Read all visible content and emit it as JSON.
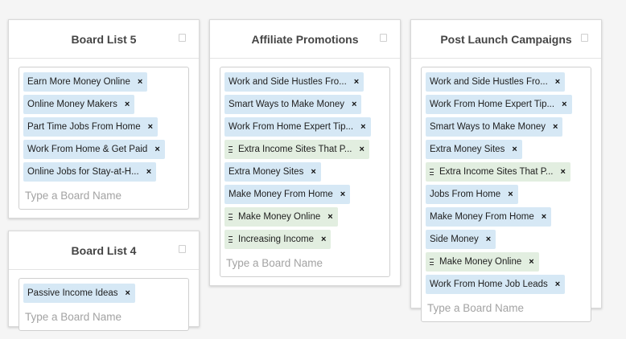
{
  "columns": [
    {
      "title": "Board List 5",
      "tags": [
        {
          "label": "Earn More Money Online",
          "draggable": false
        },
        {
          "label": "Online Money Makers",
          "draggable": false
        },
        {
          "label": "Part Time Jobs From Home",
          "draggable": false
        },
        {
          "label": "Work From Home & Get Paid",
          "draggable": false
        },
        {
          "label": "Online Jobs for Stay-at-H...",
          "draggable": false
        }
      ],
      "placeholder": "Type a Board Name"
    },
    {
      "title": "Board List 4",
      "tags": [
        {
          "label": "Passive Income Ideas",
          "draggable": false
        }
      ],
      "placeholder": "Type a Board Name"
    },
    {
      "title": "Affiliate Promotions",
      "tags": [
        {
          "label": "Work and Side Hustles Fro...",
          "draggable": false
        },
        {
          "label": "Smart Ways to Make Money",
          "draggable": false
        },
        {
          "label": "Work From Home Expert Tip...",
          "draggable": false
        },
        {
          "label": "Extra Income Sites That P...",
          "draggable": true
        },
        {
          "label": "Extra Money Sites",
          "draggable": false
        },
        {
          "label": "Make Money From Home",
          "draggable": false
        },
        {
          "label": "Make Money Online",
          "draggable": true
        },
        {
          "label": "Increasing Income",
          "draggable": true
        }
      ],
      "placeholder": "Type a Board Name"
    },
    {
      "title": "Post Launch Campaigns",
      "tags": [
        {
          "label": "Work and Side Hustles Fro...",
          "draggable": false
        },
        {
          "label": "Work From Home Expert Tip...",
          "draggable": false
        },
        {
          "label": "Smart Ways to Make Money",
          "draggable": false
        },
        {
          "label": "Extra Money Sites",
          "draggable": false
        },
        {
          "label": "Extra Income Sites That P...",
          "draggable": true
        },
        {
          "label": "Jobs From Home",
          "draggable": false
        },
        {
          "label": "Make Money From Home",
          "draggable": false
        },
        {
          "label": "Side Money",
          "draggable": false
        },
        {
          "label": "Make Money Online",
          "draggable": true
        },
        {
          "label": "Work From Home Job Leads",
          "draggable": false
        }
      ],
      "placeholder": "Type a Board Name"
    }
  ],
  "tag_remove_symbol": "×",
  "colors": {
    "tag_blue": "#d6e8f5",
    "tag_green": "#e2eee0"
  }
}
